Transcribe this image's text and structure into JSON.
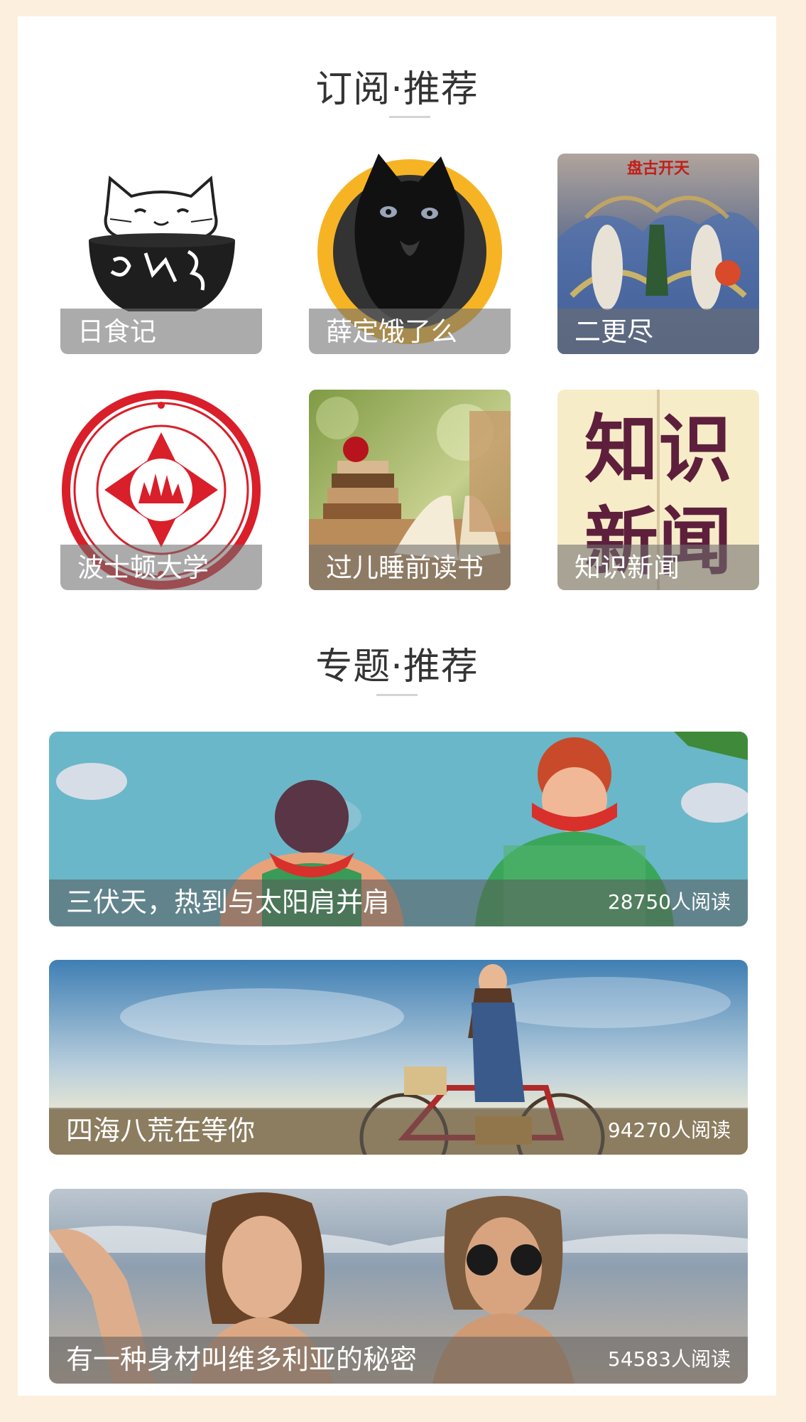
{
  "subscriptions": {
    "title": "订阅·推荐",
    "items": [
      {
        "label": "日食记",
        "icon": "cat-in-bowl-logo"
      },
      {
        "label": "薛定饿了么",
        "icon": "black-cat-avatar"
      },
      {
        "label": "二更尽",
        "icon": "mythology-painting",
        "art_text": "盘古开天"
      },
      {
        "label": "波士顿大学",
        "icon": "university-seal"
      },
      {
        "label": "过儿睡前读书",
        "icon": "books-apple-photo"
      },
      {
        "label": "知识新闻",
        "icon": "knowledge-news-logo",
        "art_text": [
          "知识",
          "新闻"
        ]
      }
    ]
  },
  "topics": {
    "title": "专题·推荐",
    "items": [
      {
        "title": "三伏天，热到与太阳肩并肩",
        "reads": "28750人阅读",
        "image": "watermelon-illustration"
      },
      {
        "title": "四海八荒在等你",
        "reads": "94270人阅读",
        "image": "woman-with-bicycle-photo"
      },
      {
        "title": "有一种身材叫维多利亚的秘密",
        "reads": "54583人阅读",
        "image": "beach-models-photo"
      }
    ]
  },
  "colors": {
    "page_background": "#fcefde",
    "card_background": "#ffffff",
    "title_text": "#333333"
  }
}
